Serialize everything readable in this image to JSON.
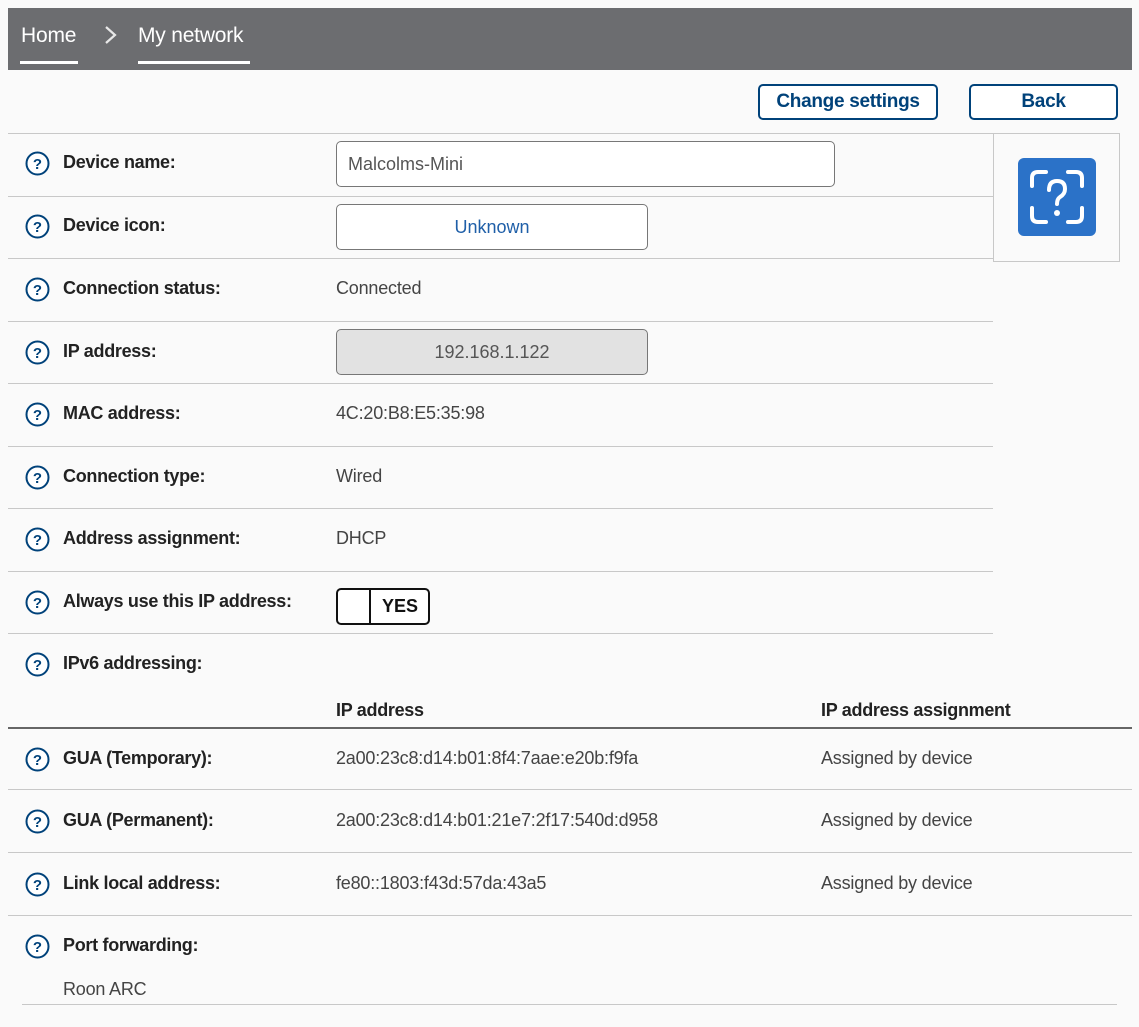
{
  "breadcrumb": {
    "home": "Home",
    "current": "My network"
  },
  "toolbar": {
    "change_label": "Change settings",
    "back_label": "Back"
  },
  "rows": [
    {
      "label": "Device name:",
      "value": "Malcolms-Mini"
    },
    {
      "label": "Device icon:",
      "value": "Unknown"
    },
    {
      "label": "Connection status:",
      "value": "Connected"
    },
    {
      "label": "IP address:",
      "value": "192.168.1.122"
    },
    {
      "label": "MAC address:",
      "value": "4C:20:B8:E5:35:98"
    },
    {
      "label": "Connection type:",
      "value": "Wired"
    },
    {
      "label": "Address assignment:",
      "value": "DHCP"
    },
    {
      "label": "Always use this IP address:",
      "value": "YES"
    },
    {
      "label": "IPv6 addressing:"
    }
  ],
  "ipv6": {
    "columns": [
      "IP address",
      "IP address assignment"
    ],
    "rows": [
      {
        "label": "GUA (Temporary):",
        "address": "2a00:23c8:d14:b01:8f4:7aae:e20b:f9fa",
        "assignment": "Assigned by device"
      },
      {
        "label": "GUA (Permanent):",
        "address": "2a00:23c8:d14:b01:21e7:2f17:540d:d958",
        "assignment": "Assigned by device"
      },
      {
        "label": "Link local address:",
        "address": "fe80::1803:f43d:57da:43a5",
        "assignment": "Assigned by device"
      }
    ]
  },
  "port_forwarding": {
    "label": "Port forwarding:",
    "value": "Roon ARC"
  },
  "icons": {
    "help": "help-circle-icon",
    "breadcrumb_sep": "chevron-right-icon",
    "device": "unknown-device-icon"
  },
  "colors": {
    "brand": "#00427a",
    "topbar": "#6c6d70",
    "icon_tile": "#2b72c8"
  }
}
